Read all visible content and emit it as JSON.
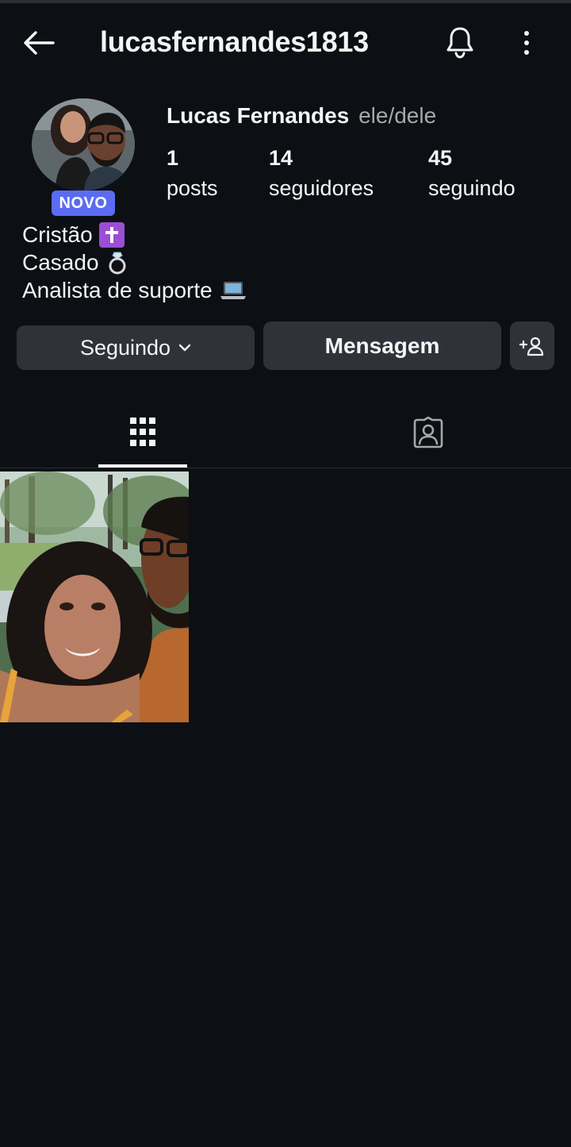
{
  "header": {
    "username": "lucasfernandes1813",
    "back_icon": "arrow-left-icon",
    "bell_icon": "bell-icon",
    "more_icon": "more-vertical-icon"
  },
  "profile": {
    "full_name": "Lucas Fernandes",
    "pronouns": "ele/dele",
    "badge": "NOVO",
    "badge_color": "#5b6cf2",
    "stats": {
      "posts_count": "1",
      "posts_label": "posts",
      "followers_count": "14",
      "followers_label": "seguidores",
      "following_count": "45",
      "following_label": "seguindo"
    },
    "bio": [
      {
        "text": "Cristão",
        "emoji": "latin-cross-emoji"
      },
      {
        "text": "Casado",
        "emoji": "ring-emoji"
      },
      {
        "text": "Analista de suporte",
        "emoji": "laptop-emoji"
      }
    ]
  },
  "actions": {
    "following_label": "Seguindo",
    "message_label": "Mensagem",
    "add_user_icon": "add-user-icon"
  },
  "tabs": [
    {
      "name": "grid",
      "icon": "grid-icon",
      "active": true
    },
    {
      "name": "tagged",
      "icon": "tagged-person-icon",
      "active": false
    }
  ],
  "posts": [
    {
      "type": "photo",
      "description_icon": "couple-photo"
    }
  ],
  "colors": {
    "background": "#0c0f14",
    "button_bg": "#2f3339",
    "text": "#f5f5f5",
    "secondary_text": "#a8a8a8"
  }
}
